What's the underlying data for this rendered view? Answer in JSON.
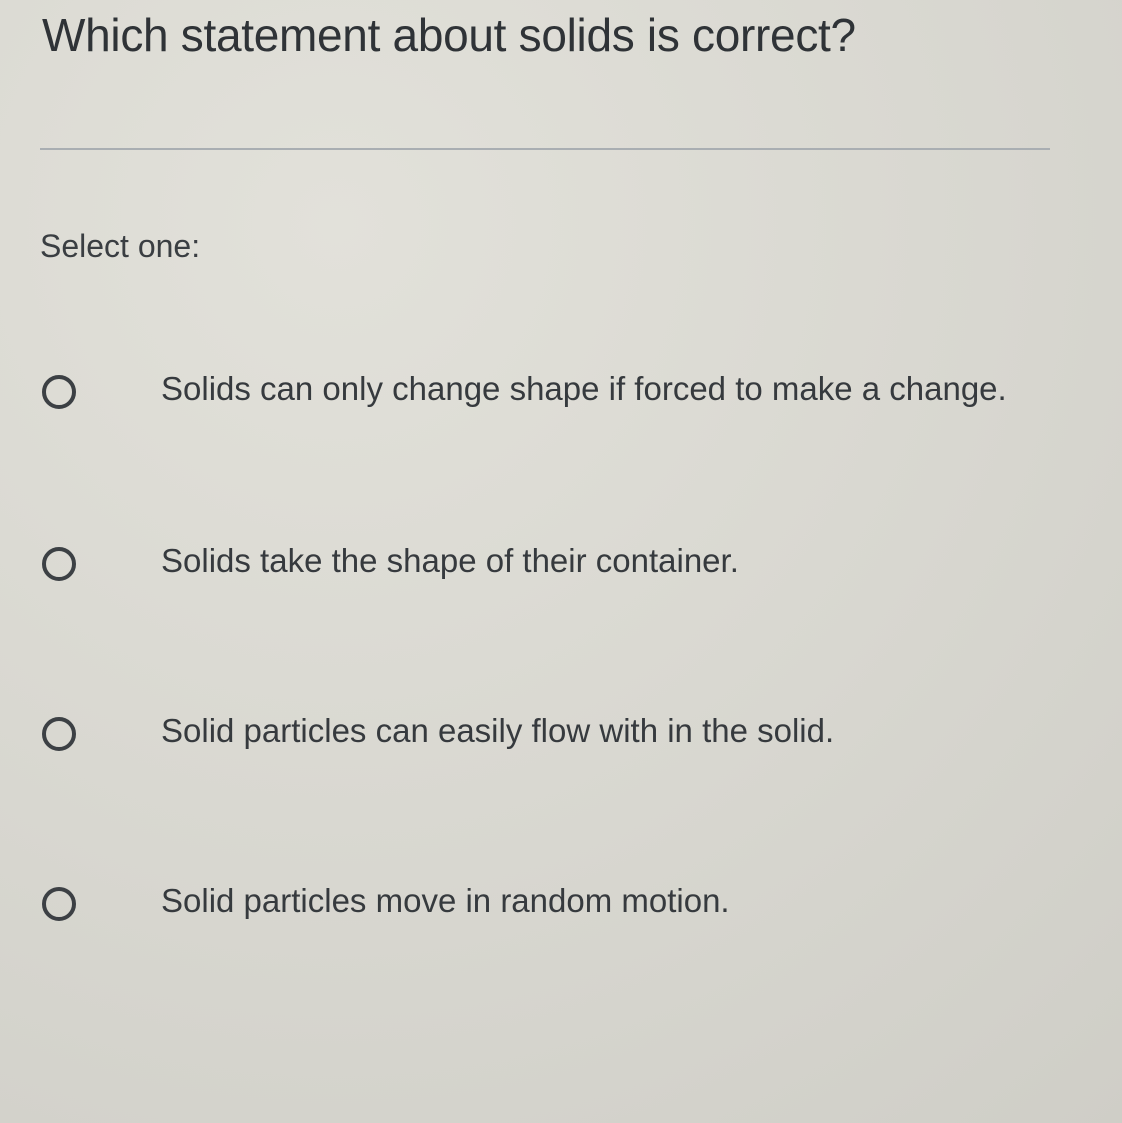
{
  "question": {
    "text": "Which statement about solids is correct?"
  },
  "prompt": {
    "text": "Select one:"
  },
  "options": [
    {
      "label": "Solids can only change shape if forced to make a change.",
      "selected": false
    },
    {
      "label": "Solids take the shape of their container.",
      "selected": false
    },
    {
      "label": "Solid particles can easily flow with in the solid.",
      "selected": false
    },
    {
      "label": "Solid particles move in random motion.",
      "selected": false
    }
  ],
  "colors": {
    "background": "#d9d8d1",
    "text": "#33373b",
    "divider": "#a9aeb2",
    "radio_border": "#3c4044"
  }
}
